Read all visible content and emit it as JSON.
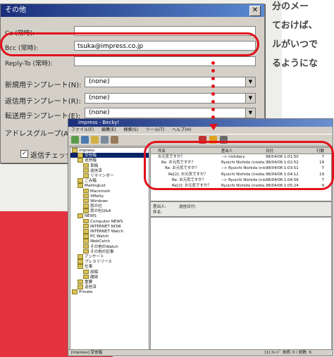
{
  "dialog": {
    "title": "その他",
    "close": "✕",
    "cc_label": "Cc (常時):",
    "bcc_label": "Bcc (常時):",
    "bcc_value": "tsuka@impress.co.jp",
    "replyto_label": "Reply-To (常時):",
    "new_tpl_label": "新規用テンプレート(N):",
    "new_tpl_value": "(none)",
    "reply_tpl_label": "返信用テンプレート(R):",
    "reply_tpl_value": "(none)",
    "fwd_tpl_label": "転送用テンプレート(E):",
    "fwd_tpl_value": "(none)",
    "addr_group_label": "アドレスグループ(A",
    "check_label": "返信チェック",
    "check_mark": "✓"
  },
  "side_text": [
    "分のメー",
    "ておけば、",
    "ルがいつで",
    "るようにな"
  ],
  "app": {
    "title": "impress - Becky!",
    "menu": [
      "ファイル(F)",
      "編集(E)",
      "検索(S)",
      "ツール(T)",
      "ヘルプ(H)"
    ],
    "tree": [
      {
        "label": "impress",
        "indent": 0
      },
      {
        "label": "受信箱",
        "indent": 1
      },
      {
        "label": "送信箱",
        "indent": 1
      },
      {
        "label": "草稿",
        "indent": 2
      },
      {
        "label": "送信済",
        "indent": 2
      },
      {
        "label": "リマインダー",
        "indent": 2
      },
      {
        "label": "ごみ箱",
        "indent": 1
      },
      {
        "label": "MailingList",
        "indent": 1
      },
      {
        "label": "Macintosh",
        "indent": 2
      },
      {
        "label": "XMelty",
        "indent": 2
      },
      {
        "label": "Windows",
        "indent": 2
      },
      {
        "label": "窓の社",
        "indent": 2
      },
      {
        "label": "窓の杜Q&A",
        "indent": 2
      },
      {
        "label": "NEWS",
        "indent": 1
      },
      {
        "label": "Computer NEWS",
        "indent": 2
      },
      {
        "label": "INTERNET NOW",
        "indent": 2
      },
      {
        "label": "INTERNET Watch",
        "indent": 2
      },
      {
        "label": "PC Watch",
        "indent": 2
      },
      {
        "label": "WebCatch",
        "indent": 2
      },
      {
        "label": "その他のWatch",
        "indent": 2
      },
      {
        "label": "その他の記事",
        "indent": 2
      },
      {
        "label": "アンケート",
        "indent": 1
      },
      {
        "label": "プレスリリース",
        "indent": 1
      },
      {
        "label": "仕事",
        "indent": 1
      },
      {
        "label": "原稿",
        "indent": 2
      },
      {
        "label": "雑誌",
        "indent": 2
      },
      {
        "label": "重要",
        "indent": 1
      },
      {
        "label": "返信済",
        "indent": 1
      },
      {
        "label": "Private",
        "indent": 0
      }
    ],
    "list_headers": [
      "件名",
      "差出人",
      "日付",
      "行数"
    ],
    "list_rows": [
      {
        "subject": "お元気ですか？",
        "from": "--> nishdary",
        "date": "98/04/06 1:01:50",
        "lines": "7"
      },
      {
        "subject": "Re: お元気ですか？",
        "from": "Ryuichi Nishida (nisida.",
        "date": "98/04/06 1:02:52",
        "lines": "19"
      },
      {
        "subject": "Re: お元気ですか？",
        "from": "--> Ryuichi Nishida (nis.",
        "date": "98/04/06 1:03:51",
        "lines": "7"
      },
      {
        "subject": "Re[2]: お元気ですか？",
        "from": "Ryuichi Nishida (nisida.",
        "date": "98/04/06 1:04:12",
        "lines": "19"
      },
      {
        "subject": "Re: お元気ですか？",
        "from": "--> Ryuichi Nishida (nis.",
        "date": "98/04/06 1:04:56",
        "lines": "7"
      },
      {
        "subject": "Re[2]: お元気ですか？",
        "from": "Ryuichi Nishida (nisida.",
        "date": "98/04/06 1:05:24",
        "lines": "9"
      }
    ],
    "preview_from": "差出人:",
    "preview_to": "送信日付:",
    "preview_subject": "件名:",
    "status_left": "[impress] 受信箱",
    "status_right": "[1] ｽﾚｯﾄﾞ 未読: 0 / 総数: 6"
  },
  "colors": {
    "accent_red": "#e2111b",
    "bg_red": "#e2333f",
    "titlebar": "#1a2e7a"
  }
}
